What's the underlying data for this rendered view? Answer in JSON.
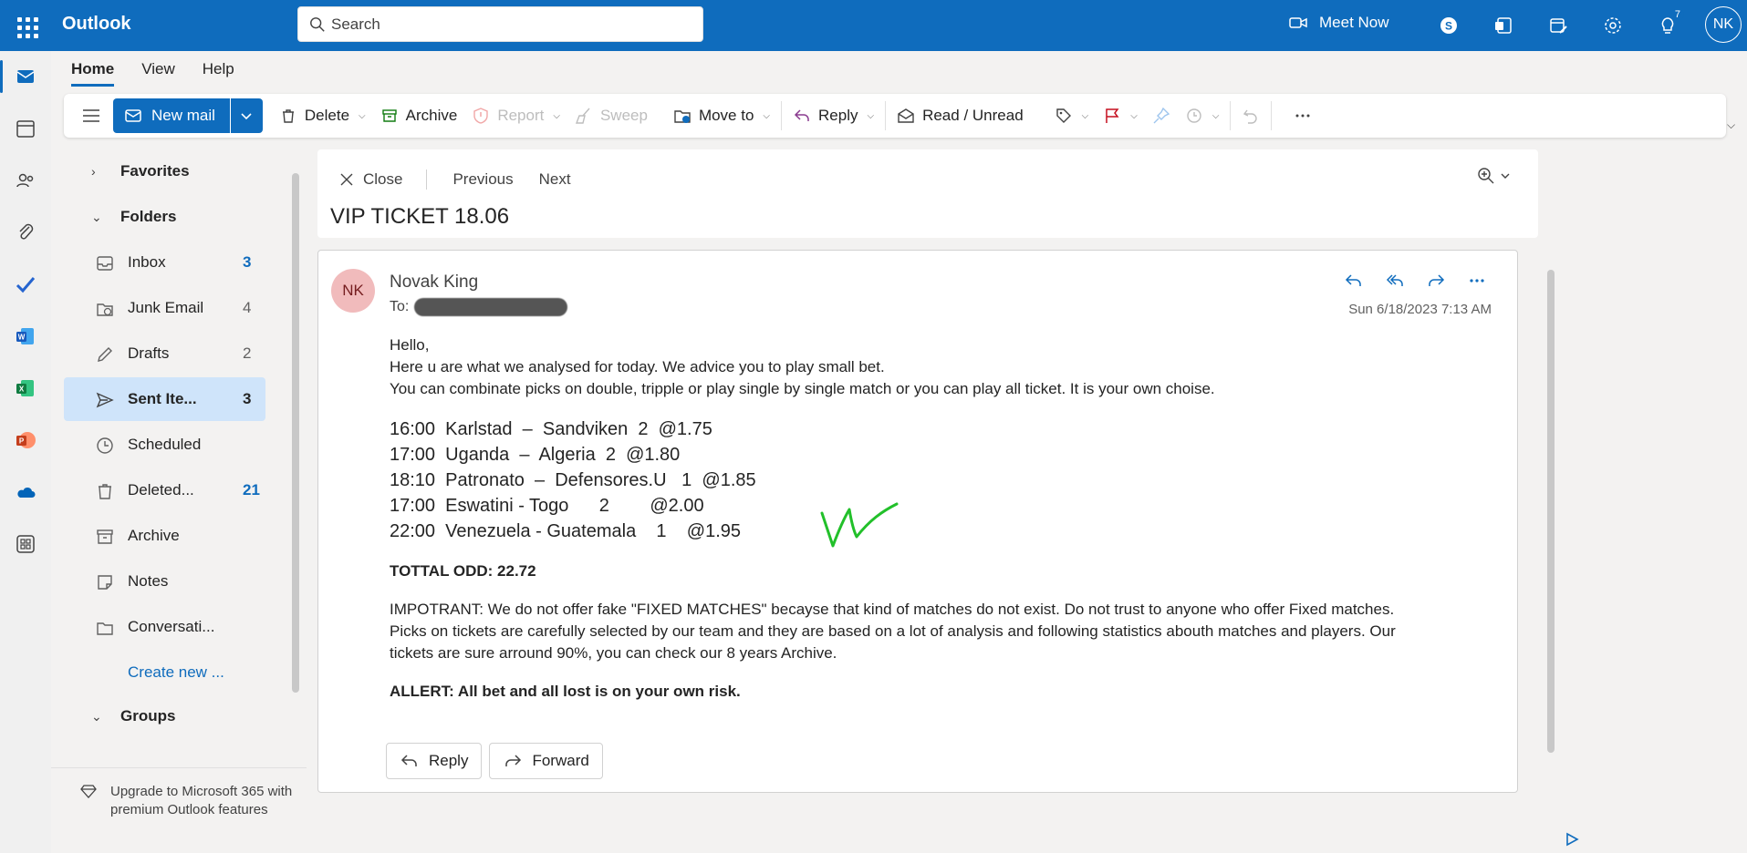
{
  "app": {
    "title": "Outlook"
  },
  "search": {
    "placeholder": "Search"
  },
  "top_right": {
    "meet_now": "Meet Now",
    "tips_badge": "7",
    "user_initials": "NK"
  },
  "tabs": [
    {
      "label": "Home"
    },
    {
      "label": "View"
    },
    {
      "label": "Help"
    }
  ],
  "ribbon": {
    "new_mail": "New mail",
    "delete": "Delete",
    "archive": "Archive",
    "report": "Report",
    "sweep": "Sweep",
    "move_to": "Move to",
    "reply": "Reply",
    "read_unread": "Read / Unread"
  },
  "folders": {
    "favorites": "Favorites",
    "folders": "Folders",
    "items": [
      {
        "label": "Inbox",
        "count": "3"
      },
      {
        "label": "Junk Email",
        "count": "4"
      },
      {
        "label": "Drafts",
        "count": "2"
      },
      {
        "label": "Sent Ite...",
        "count": "3"
      },
      {
        "label": "Scheduled",
        "count": ""
      },
      {
        "label": "Deleted...",
        "count": "21"
      },
      {
        "label": "Archive",
        "count": ""
      },
      {
        "label": "Notes",
        "count": ""
      },
      {
        "label": "Conversati...",
        "count": ""
      }
    ],
    "create_new": "Create new ...",
    "groups": "Groups",
    "upgrade": "Upgrade to Microsoft 365 with premium Outlook features"
  },
  "reading": {
    "close": "Close",
    "previous": "Previous",
    "next": "Next",
    "subject": "VIP TICKET 18.06"
  },
  "message": {
    "sender_initials": "NK",
    "sender_name": "Novak King",
    "to_label": "To:",
    "date": "Sun 6/18/2023 7:13 AM",
    "greeting": "Hello,",
    "line1": "Here u are what we analysed for today. We advice you to play small bet.",
    "line2": "You can combinate picks on double, tripple or play single by single match or you can play all ticket. It is your own choise.",
    "picks": [
      "16:00  Karlstad  –  Sandviken  2  @1.75",
      "17:00  Uganda  –  Algeria  2  @1.80",
      "18:10  Patronato  –  Defensores.U   1  @1.85",
      "17:00  Eswatini - Togo      2        @2.00",
      "22:00  Venezuela - Guatemala    1    @1.95"
    ],
    "total_odd": "TOTTAL ODD: 22.72",
    "important": "IMPOTRANT: We do not offer fake \"FIXED MATCHES\" becayse that kind of matches do not exist. Do not trust to anyone who offer Fixed matches.",
    "picks_info": "Picks on tickets are carefully selected by our team and they are based on a lot of analysis and following statistics abouth matches and players. Our",
    "archive_info": "tickets are sure arround 90%, you can check our 8 years Archive.",
    "allert": "ALLERT: All bet and all lost is on your own risk.",
    "reply_button": "Reply",
    "forward_button": "Forward"
  },
  "colors": {
    "brand": "#0f6cbd",
    "selected": "#cfe4fa",
    "avatar_bg": "#f1bbbc",
    "check_green": "#22c02a"
  }
}
